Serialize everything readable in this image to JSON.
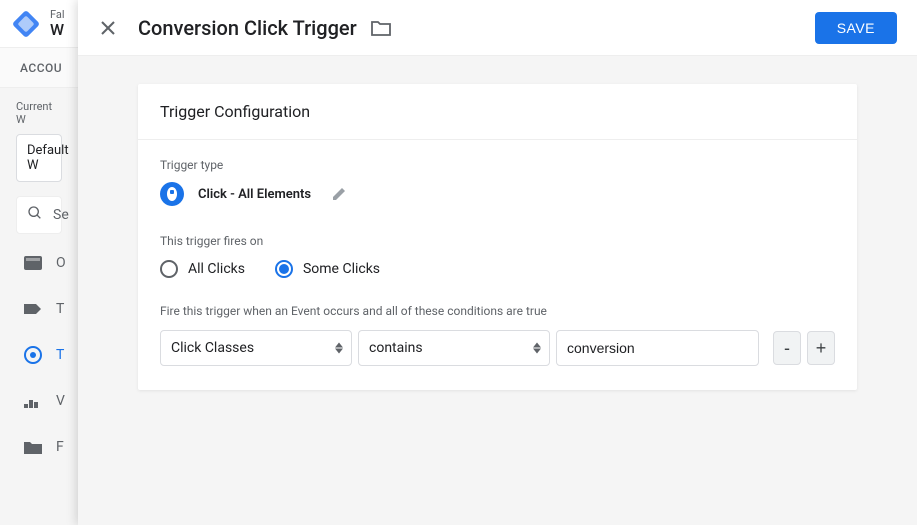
{
  "bg": {
    "top_small": "Fal",
    "top_big": "W",
    "accounts_label": "ACCOU",
    "current_ws_label": "Current W",
    "ws_name": "Default W",
    "search_placeholder": "Se",
    "nav": {
      "overview": "O",
      "tags": "T",
      "triggers": "T",
      "variables": "V",
      "folders": "F"
    }
  },
  "overlay": {
    "title": "Conversion Click Trigger",
    "save_label": "SAVE"
  },
  "card": {
    "header": "Trigger Configuration",
    "trigger_type_label": "Trigger type",
    "trigger_type_name": "Click - All Elements",
    "fires_on_label": "This trigger fires on",
    "radio_all": "All Clicks",
    "radio_some": "Some Clicks",
    "condition_label": "Fire this trigger when an Event occurs and all of these conditions are true",
    "cond_variable": "Click Classes",
    "cond_operator": "contains",
    "cond_value": "conversion",
    "minus": "-",
    "plus": "+"
  }
}
